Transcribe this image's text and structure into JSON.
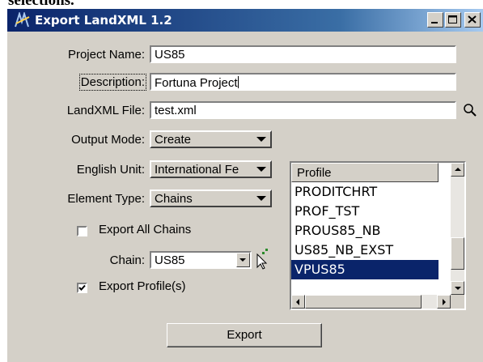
{
  "page_fragment": "selections.",
  "window": {
    "title": "Export LandXML 1.2",
    "icons": {
      "app": "landxml-app-icon",
      "minimize": "minimize-icon",
      "maximize": "maximize-icon",
      "close": "close-icon"
    }
  },
  "form": {
    "project_name": {
      "label": "Project Name:",
      "value": "US85"
    },
    "description": {
      "label": "Description:",
      "value": "Fortuna Project"
    },
    "landxml_file": {
      "label": "LandXML File:",
      "value": "test.xml",
      "browse_icon": "magnifier-icon"
    },
    "output_mode": {
      "label": "Output Mode:",
      "value": "Create"
    },
    "english_unit": {
      "label": "English Unit:",
      "value": "International Fe"
    },
    "element_type": {
      "label": "Element Type:",
      "value": "Chains"
    },
    "export_all_chains": {
      "label": "Export All Chains",
      "checked": false
    },
    "chain": {
      "label": "Chain:",
      "value": "US85",
      "pick_icon": "pointer-pick-icon"
    },
    "export_profiles": {
      "label": "Export Profile(s)",
      "checked": true
    }
  },
  "profile_list": {
    "header": "Profile",
    "items": [
      "PRODITCHRT",
      "PROF_TST",
      "PROUS85_NB",
      "US85_NB_EXST",
      "VPUS85"
    ],
    "selected": "VPUS85"
  },
  "export_button": {
    "label": "Export"
  },
  "colors": {
    "titlebar_start": "#0a246a",
    "titlebar_end": "#a6caf0",
    "selection": "#0a246a",
    "face": "#d4d0c8"
  }
}
